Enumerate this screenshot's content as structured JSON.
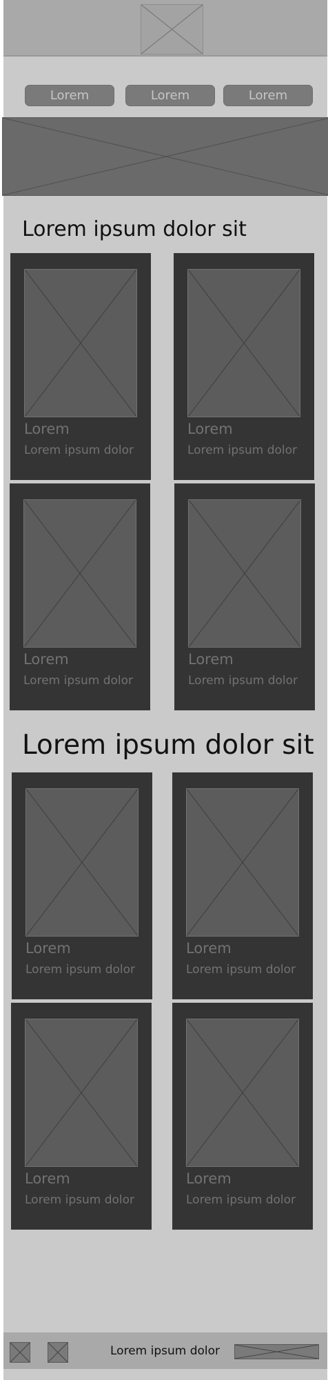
{
  "nav": {
    "items": [
      "Lorem",
      "Lorem",
      "Lorem"
    ]
  },
  "sections": [
    {
      "title": "Lorem ipsum dolor sit",
      "cards": [
        {
          "title": "Lorem",
          "subtitle": "Lorem ipsum dolor"
        },
        {
          "title": "Lorem",
          "subtitle": "Lorem ipsum dolor"
        },
        {
          "title": "Lorem",
          "subtitle": "Lorem ipsum dolor"
        },
        {
          "title": "Lorem",
          "subtitle": "Lorem ipsum dolor"
        }
      ]
    },
    {
      "title": "Lorem ipsum dolor sit",
      "cards": [
        {
          "title": "Lorem",
          "subtitle": "Lorem ipsum dolor"
        },
        {
          "title": "Lorem",
          "subtitle": "Lorem ipsum dolor"
        },
        {
          "title": "Lorem",
          "subtitle": "Lorem ipsum dolor"
        },
        {
          "title": "Lorem",
          "subtitle": "Lorem ipsum dolor"
        }
      ]
    }
  ],
  "footer": {
    "text": "Lorem ipsum dolor"
  },
  "icons": {
    "logo": "image-placeholder-icon",
    "hero": "image-placeholder-icon",
    "card_image": "image-placeholder-icon",
    "footer_icons": [
      "image-placeholder-icon",
      "image-placeholder-icon"
    ],
    "footer_bar": "image-placeholder-icon"
  },
  "colors": {
    "page_background": "#cacaca",
    "header_background": "#a9a9a9",
    "nav_button": "#7a7a7a",
    "hero": "#6a6a6a",
    "card_background": "#343434",
    "card_image": "#5c5c5c",
    "card_text": "#727272"
  }
}
